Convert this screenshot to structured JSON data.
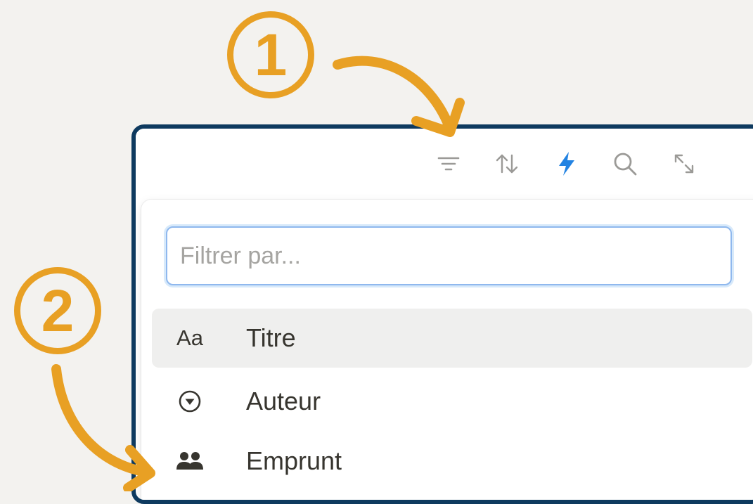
{
  "toolbar": {
    "icons": [
      "filter-icon",
      "sort-icon",
      "automation-lightning-icon",
      "search-icon",
      "expand-icon"
    ],
    "accent_color": "#2383e2"
  },
  "filter": {
    "placeholder": "Filtrer par...",
    "value": ""
  },
  "options": [
    {
      "icon_text": "Aa",
      "icon": "text-property-icon",
      "label": "Titre",
      "highlighted": true
    },
    {
      "icon": "select-property-icon",
      "label": "Auteur",
      "highlighted": false
    },
    {
      "icon": "person-property-icon",
      "label": "Emprunt",
      "highlighted": false
    }
  ],
  "annotations": {
    "step1": "1",
    "step2": "2",
    "color": "#e8a024"
  },
  "colors": {
    "frame_border": "#0e3a5f",
    "background": "#f3f2ef"
  }
}
